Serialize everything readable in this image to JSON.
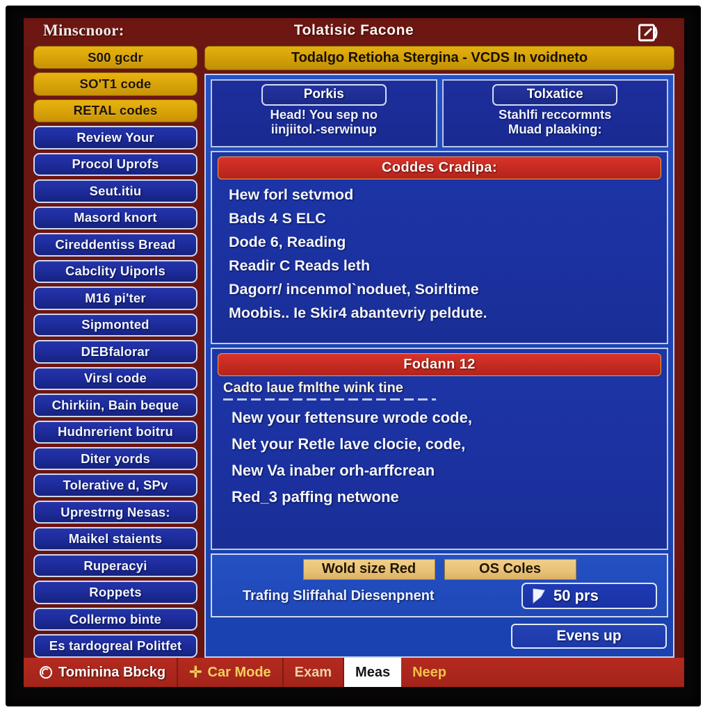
{
  "window": {
    "label": "Minscnoor:",
    "title": "Tolatisic Facone",
    "ext_icon": "external-window-icon"
  },
  "sidebar": {
    "items": [
      {
        "label": "S00 gcdr",
        "style": "gold"
      },
      {
        "label": "SO'T1 code",
        "style": "gold"
      },
      {
        "label": "RETAL codes",
        "style": "gold"
      },
      {
        "label": "Review Your",
        "style": "blue"
      },
      {
        "label": "Procol Uprofs",
        "style": "blue"
      },
      {
        "label": "Seut.itiu",
        "style": "blue"
      },
      {
        "label": "Masord knort",
        "style": "blue"
      },
      {
        "label": "Cireddentiss Bread",
        "style": "blue"
      },
      {
        "label": "Cabclity Uiporls",
        "style": "blue"
      },
      {
        "label": "M16 pi'ter",
        "style": "blue"
      },
      {
        "label": "Sipmonted",
        "style": "blue"
      },
      {
        "label": "DEBfalorar",
        "style": "blue"
      },
      {
        "label": "Virsl code",
        "style": "blue"
      },
      {
        "label": "Chirkiin, Bain beque",
        "style": "blue"
      },
      {
        "label": "Hudnrerient boitru",
        "style": "blue"
      },
      {
        "label": "Diter yords",
        "style": "blue"
      },
      {
        "label": "Tolerative d, SPv",
        "style": "blue"
      },
      {
        "label": "Uprestrng Nesas:",
        "style": "blue"
      },
      {
        "label": "Maikel staients",
        "style": "blue"
      },
      {
        "label": "Ruperacyi",
        "style": "blue"
      },
      {
        "label": "Roppets",
        "style": "blue"
      },
      {
        "label": "Collermo binte",
        "style": "blue"
      },
      {
        "label": "Es tardogreal Politfet",
        "style": "blue"
      }
    ]
  },
  "main": {
    "subtitle": "Todalgo Retioha Stergina - VCDS In voidneto",
    "info_boxes": [
      {
        "caption": "Porkis",
        "lines": [
          "Head! You sep no",
          "iinjiitol.-serwinup"
        ]
      },
      {
        "caption": "Tolxatice",
        "lines": [
          "Stahlfi reccormnts",
          "Muad plaaking:"
        ]
      }
    ],
    "panel1": {
      "caption": "Coddes Cradipa:",
      "lines": [
        "Hew forl setvmod",
        "Bads 4 S ELC",
        "Dode 6, Reading",
        "Readir C Reads  leth",
        "Dagorr/ incenmol`noduet, Soirltime",
        "Moobis.. Ie Skir4 abantevriy peldute."
      ]
    },
    "panel2": {
      "caption": "Fodann 12",
      "note": "Cadto laue fmlthe wink tine",
      "lines": [
        "New your fettensure wrode code,",
        "Net your Retle lave clocie, code,",
        "New Va inaber orh-arffcrean",
        "Red_3 paffing netwone"
      ]
    },
    "actions": {
      "buttons": [
        {
          "label": "Wold size Red"
        },
        {
          "label": "OS Coles"
        }
      ],
      "status_text": "Trafing Sliffahal Diesenpnent",
      "counter": {
        "icon": "flag-icon",
        "value": "50  prs"
      },
      "evens_button": "Evens up"
    }
  },
  "statusbar": {
    "segments": [
      {
        "label": "Tominina Bbckg",
        "style": "title",
        "icon": "ring-icon"
      },
      {
        "label": "Car Mode",
        "style": "gold",
        "icon": "plus-icon"
      },
      {
        "label": "Exam",
        "style": "plain",
        "icon": null
      },
      {
        "label": "Meas",
        "style": "active",
        "icon": null
      },
      {
        "label": "Neep",
        "style": "neep",
        "icon": null
      }
    ]
  },
  "colors": {
    "header_red": "#6d1713",
    "gold": "#d9a408",
    "panel_blue": "#1b44b4",
    "cap_red": "#c62b22",
    "statusbar_red": "#b42a1f"
  }
}
